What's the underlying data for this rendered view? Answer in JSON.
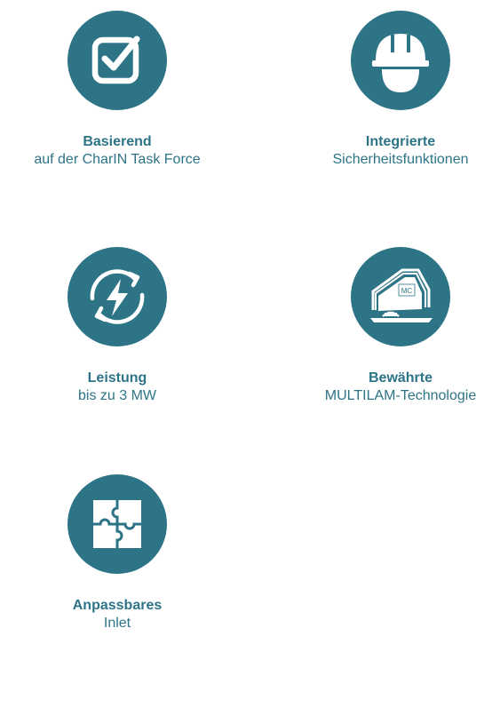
{
  "colors": {
    "accent": "#2E7487",
    "text": "#2E7487",
    "icon_fg": "#ffffff"
  },
  "features": [
    {
      "icon": "checkbox-icon",
      "title": "Basierend",
      "subtitle": "auf der CharIN Task Force"
    },
    {
      "icon": "hard-hat-icon",
      "title": "Integrierte",
      "subtitle": "Sicherheitsfunktionen"
    },
    {
      "icon": "power-cycle-icon",
      "title": "Leistung",
      "subtitle": "bis zu 3 MW"
    },
    {
      "icon": "connector-contact-icon",
      "title": "Bewährte",
      "subtitle": "MULTILAM-Technologie",
      "logo_text": "MC"
    },
    {
      "icon": "puzzle-icon",
      "title": "Anpassbares",
      "subtitle": "Inlet"
    }
  ]
}
